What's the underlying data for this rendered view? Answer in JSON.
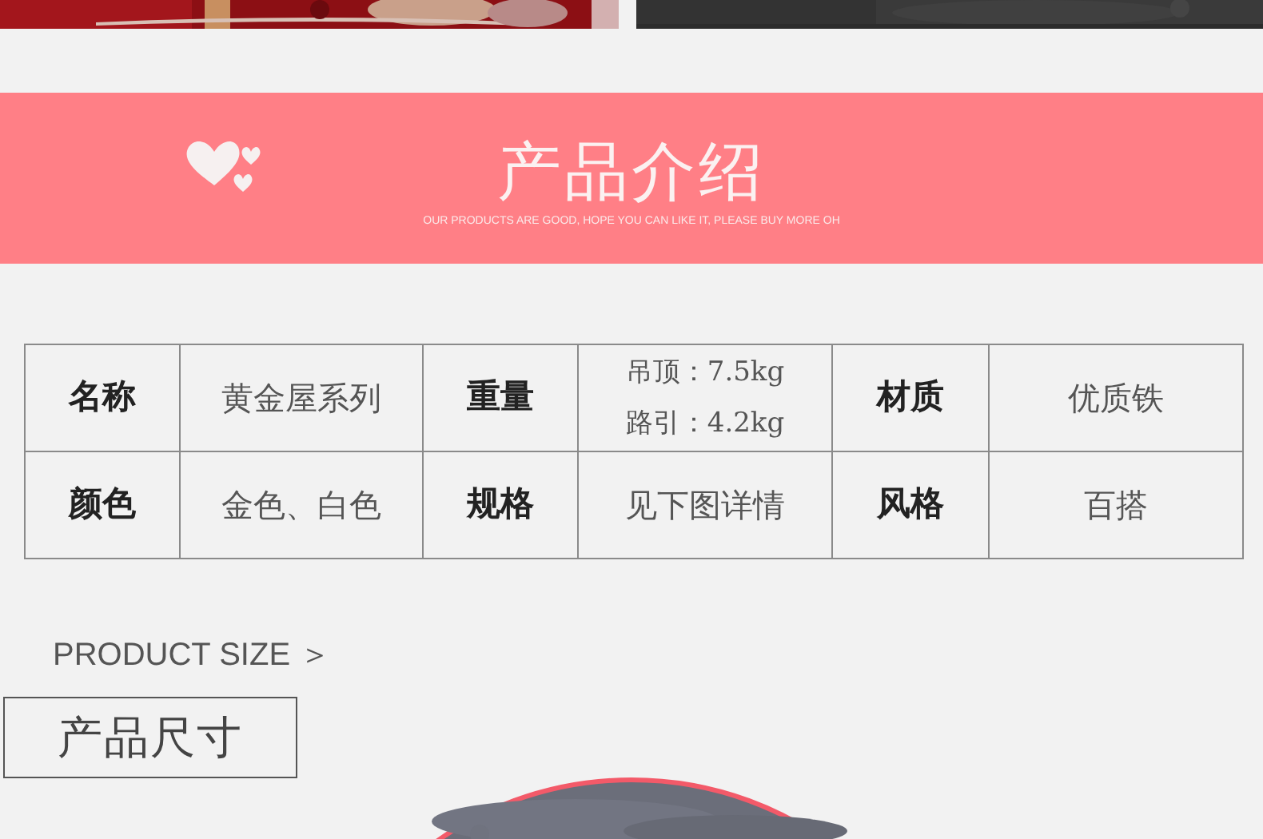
{
  "banner": {
    "title": "产品介绍",
    "subtitle": "OUR PRODUCTS ARE GOOD, HOPE YOU CAN LIKE IT, PLEASE BUY MORE OH"
  },
  "spec_table": {
    "rows": [
      [
        {
          "label": "名称",
          "value": [
            "黄金屋系列"
          ]
        },
        {
          "label": "重量",
          "value": [
            "吊顶：7.5kg",
            "路引：4.2kg"
          ]
        },
        {
          "label": "材质",
          "value": [
            "优质铁"
          ]
        }
      ],
      [
        {
          "label": "颜色",
          "value": [
            "金色、白色"
          ]
        },
        {
          "label": "规格",
          "value": [
            "见下图详情"
          ]
        },
        {
          "label": "风格",
          "value": [
            "百搭"
          ]
        }
      ]
    ]
  },
  "size_section": {
    "caption": "PRODUCT SIZE ＞",
    "title": "产品尺寸"
  }
}
